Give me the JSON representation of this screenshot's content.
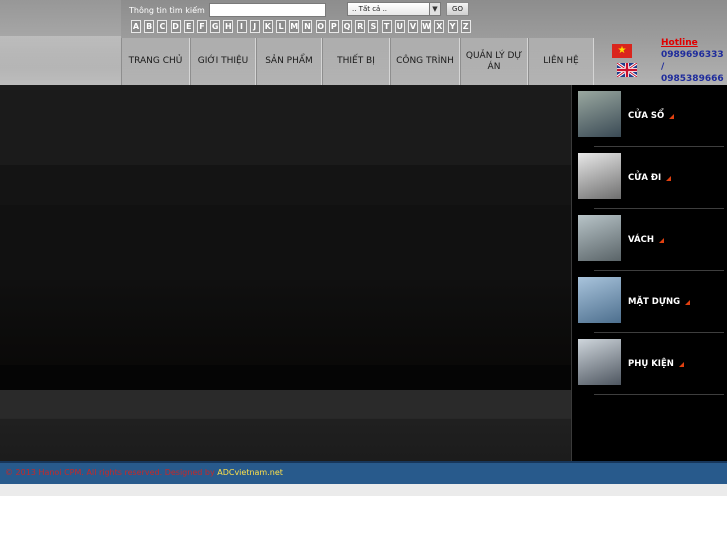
{
  "search": {
    "label": "Thông tin tìm kiếm",
    "input_value": "",
    "category_selected": ".. Tất cả ..",
    "go_label": "GO"
  },
  "alphabet": [
    "A",
    "B",
    "C",
    "D",
    "E",
    "F",
    "G",
    "H",
    "I",
    "J",
    "K",
    "L",
    "M",
    "N",
    "O",
    "P",
    "Q",
    "R",
    "S",
    "T",
    "U",
    "V",
    "W",
    "X",
    "Y",
    "Z"
  ],
  "nav": [
    {
      "label": "TRANG CHỦ",
      "width": 69
    },
    {
      "label": "GIỚI THIỆU",
      "width": 66
    },
    {
      "label": "SẢN PHẨM",
      "width": 66
    },
    {
      "label": "THIẾT BỊ",
      "width": 68
    },
    {
      "label": "CÔNG TRÌNH",
      "width": 70
    },
    {
      "label": "QUẢN LÝ DỰ ÁN",
      "width": 68
    },
    {
      "label": "LIÊN HỆ",
      "width": 66
    }
  ],
  "hotline": {
    "title": "Hotline",
    "numbers": [
      "0989696333",
      "/",
      "0985389666"
    ]
  },
  "sidebar": {
    "items": [
      {
        "label": "CỬA SỔ",
        "icon": "window-thumbnail",
        "tone": [
          "#9aa8a0",
          "#3a4a55"
        ]
      },
      {
        "label": "CỬA ĐI",
        "icon": "door-thumbnail",
        "tone": [
          "#e8e8e8",
          "#6f6f6f"
        ]
      },
      {
        "label": "VÁCH",
        "icon": "partition-thumbnail",
        "tone": [
          "#b8c4c8",
          "#5a6468"
        ]
      },
      {
        "label": "MẶT DỰNG",
        "icon": "facade-thumbnail",
        "tone": [
          "#a9c4dc",
          "#4d6f8e"
        ]
      },
      {
        "label": "PHỤ KIỆN",
        "icon": "accessory-thumbnail",
        "tone": [
          "#cfd6dc",
          "#4e5660"
        ]
      }
    ]
  },
  "footer": {
    "copyright": "© 2013 Hanoi CPM. All rights reserved. Designed by",
    "designer": "ADCvietnam.net"
  },
  "colors": {
    "footer_bg": "#285a8c",
    "hotline_title": "#e00000",
    "hotline_number": "#1f2c9c",
    "sidebar_arrow": "#e04010"
  }
}
